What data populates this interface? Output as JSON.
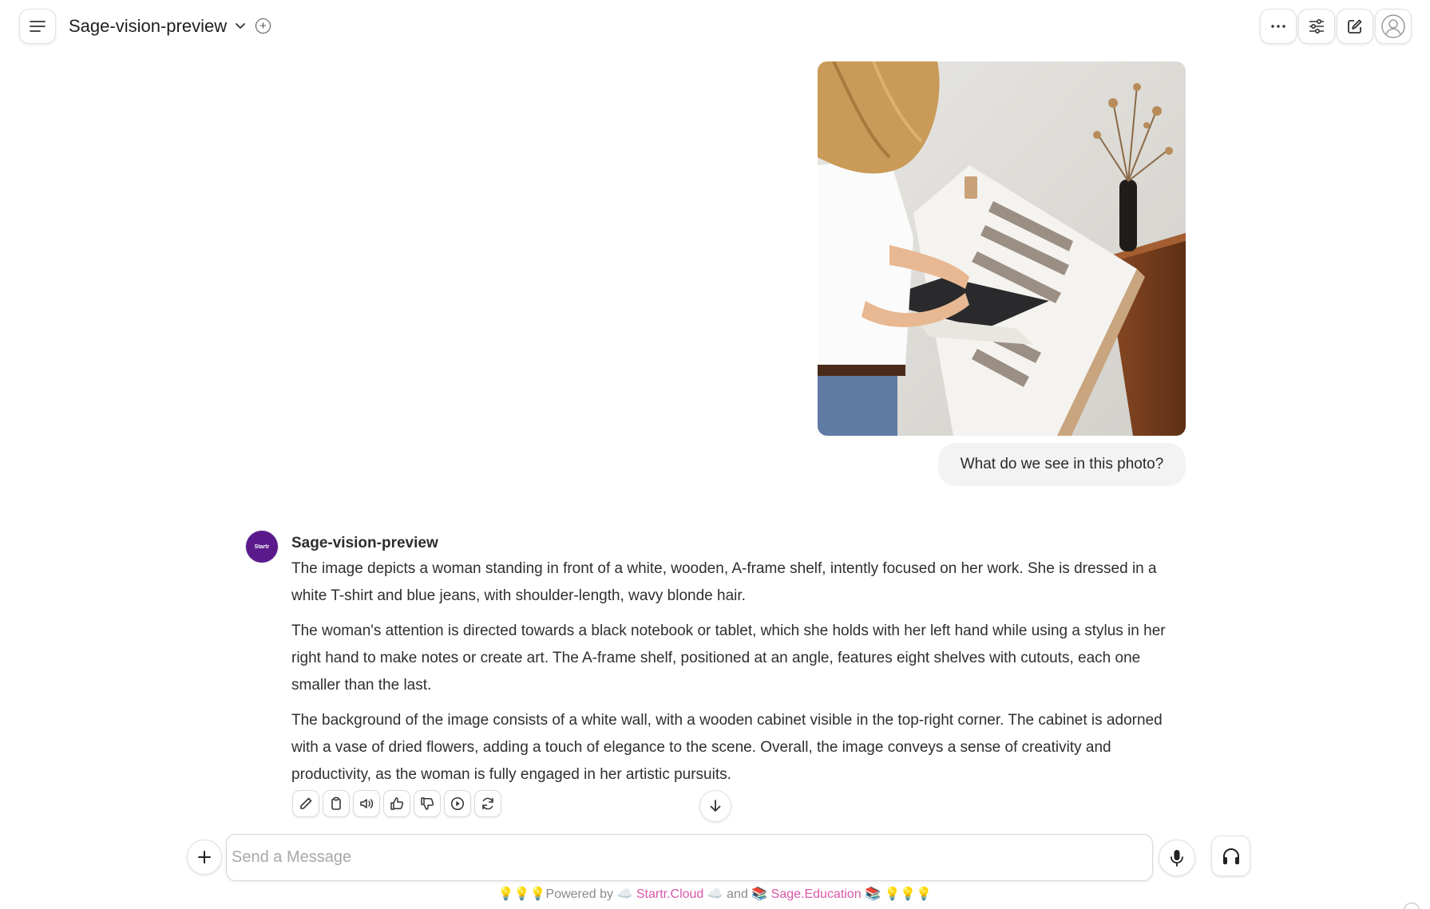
{
  "header": {
    "model_name": "Sage-vision-preview",
    "icons": [
      "menu-icon",
      "chevron-down-icon",
      "plus-icon",
      "more-icon",
      "sliders-icon",
      "edit-icon",
      "user-icon"
    ]
  },
  "user_message": {
    "image_description_icon": "photo",
    "text": "What do we see in this photo?"
  },
  "assistant_message": {
    "avatar_text": "Startr",
    "name": "Sage-vision-preview",
    "paragraphs": [
      "The image depicts a woman standing in front of a white, wooden, A-frame shelf, intently focused on her work. She is dressed in a white T-shirt and blue jeans, with shoulder-length, wavy blonde hair.",
      "The woman's attention is directed towards a black notebook or tablet, which she holds with her left hand while using a stylus in her right hand to make notes or create art. The A-frame shelf, positioned at an angle, features eight shelves with cutouts, each one smaller than the last.",
      "The background of the image consists of a white wall, with a wooden cabinet visible in the top-right corner. The cabinet is adorned with a vase of dried flowers, adding a touch of elegance to the scene. Overall, the image conveys a sense of creativity and productivity, as the woman is fully engaged in her artistic pursuits."
    ],
    "action_icons": [
      "edit-icon",
      "copy-icon",
      "speaker-icon",
      "thumbs-up-icon",
      "thumbs-down-icon",
      "play-icon",
      "regenerate-icon"
    ]
  },
  "composer": {
    "placeholder": "Send a Message"
  },
  "footer": {
    "prefix": "💡💡💡Powered by ☁️ ",
    "link1": "Startr.Cloud",
    "middle": " ☁️  and  📚 ",
    "link2": "Sage.Education",
    "suffix": " 📚  💡💡💡"
  },
  "colors": {
    "accent_link": "#d957a8",
    "avatar_bg": "#5a1a8c",
    "bubble_bg": "#f3f3f3"
  }
}
